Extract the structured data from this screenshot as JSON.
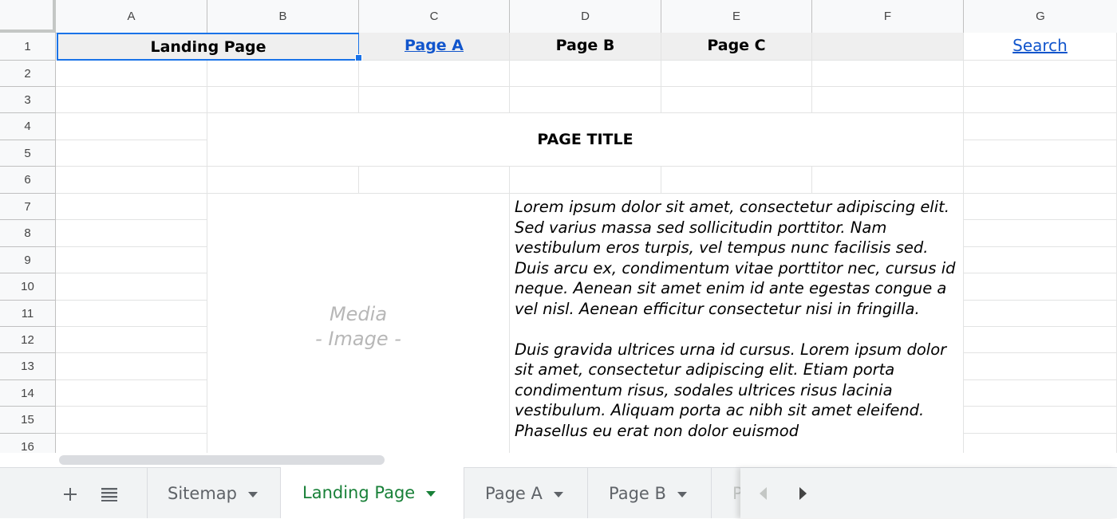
{
  "columns": [
    "A",
    "B",
    "C",
    "D",
    "E",
    "F",
    "G"
  ],
  "rows": [
    "1",
    "2",
    "3",
    "4",
    "5",
    "6",
    "7",
    "8",
    "9",
    "10",
    "11",
    "12",
    "13",
    "14",
    "15",
    "16"
  ],
  "nav": {
    "landing": "Landing Page",
    "page_a": "Page A",
    "page_b": "Page B",
    "page_c": "Page C",
    "search": "Search"
  },
  "title": "PAGE TITLE",
  "media": {
    "line1": "Media",
    "line2": "- Image -"
  },
  "body_text": {
    "p1": "Lorem ipsum dolor sit amet, consectetur adipiscing elit. Sed varius massa sed sollicitudin porttitor. Nam vestibulum eros turpis, vel tempus nunc facilisis sed. Duis arcu ex, condimentum vitae porttitor nec, cursus id neque. Aenean sit amet enim id ante egestas congue a vel nisl. Aenean efficitur consectetur nisi in fringilla.",
    "p2": "Duis gravida ultrices urna id cursus. Lorem ipsum dolor sit amet, consectetur adipiscing elit. Etiam porta condimentum risus, sodales ultrices risus lacinia vestibulum. Aliquam porta ac nibh sit amet eleifend. Phasellus eu erat non dolor euismod"
  },
  "toolbar_icons": {
    "add": "plus-icon",
    "list": "list-icon"
  },
  "sheet_tabs": {
    "sitemap": "Sitemap",
    "landing": "Landing Page",
    "page_a": "Page A",
    "page_b": "Page B",
    "partial": "P"
  },
  "colors": {
    "link": "#1155cc",
    "active_tab": "#188038",
    "selection": "#1a73e8",
    "nav_bg": "#efefef"
  }
}
